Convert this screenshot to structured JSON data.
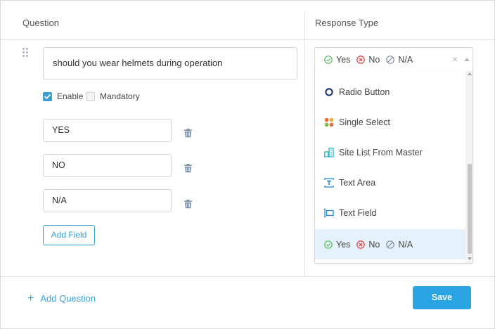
{
  "header": {
    "question_label": "Question",
    "response_type_label": "Response Type"
  },
  "question": {
    "text": "should you wear helmets during operation",
    "enable_label": "Enable",
    "enable_checked": true,
    "mandatory_label": "Mandatory",
    "mandatory_checked": false,
    "options": [
      {
        "value": "YES"
      },
      {
        "value": "NO"
      },
      {
        "value": "N/A"
      }
    ],
    "add_field_label": "Add Field"
  },
  "response": {
    "selected_values": [
      {
        "label": "Yes",
        "icon": "check-circle-icon",
        "color": "#5cb85c"
      },
      {
        "label": "No",
        "icon": "x-circle-icon",
        "color": "#e04848"
      },
      {
        "label": "N/A",
        "icon": "slash-circle-icon",
        "color": "#7f8fa6"
      }
    ],
    "clear_symbol": "×",
    "menu_items": [
      {
        "label": "Radio Button",
        "icon": "radio-button-icon"
      },
      {
        "label": "Single Select",
        "icon": "single-select-icon"
      },
      {
        "label": "Site List From Master",
        "icon": "site-list-icon"
      },
      {
        "label": "Text Area",
        "icon": "text-area-icon"
      },
      {
        "label": "Text Field",
        "icon": "text-field-icon"
      }
    ],
    "selected_item": {
      "yes": "Yes",
      "no": "No",
      "na": "N/A"
    }
  },
  "footer": {
    "add_question_plus": "+",
    "add_question_label": "Add Question",
    "save_label": "Save"
  },
  "colors": {
    "accent": "#2ba4e3",
    "icon_blue": "#35a0d8",
    "trash_icon": "#7d90aa",
    "selected_row": "#e6f2fb"
  }
}
